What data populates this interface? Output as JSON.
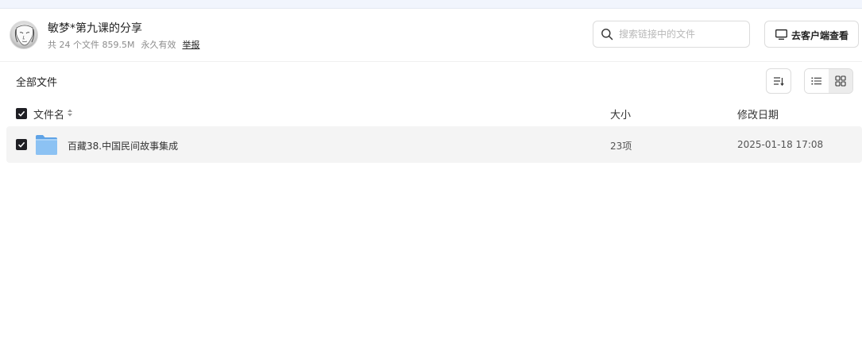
{
  "share": {
    "title": "敏梦*第九课的分享",
    "file_summary": "共 24 个文件 859.5M",
    "validity": "永久有效",
    "report_label": "举报"
  },
  "search": {
    "placeholder": "搜索链接中的文件",
    "value": ""
  },
  "client_button": {
    "label": "去客户端查看",
    "icon": "monitor-icon"
  },
  "toolbar": {
    "section_title": "全部文件",
    "sort_icon": "sort-list-icon",
    "view_options": [
      "list-view-icon",
      "grid-view-icon"
    ],
    "active_view": "grid"
  },
  "table": {
    "columns": {
      "name": "文件名",
      "size": "大小",
      "modified": "修改日期"
    },
    "select_all_checked": true,
    "rows": [
      {
        "checked": true,
        "type": "folder",
        "name": "百藏38.中国民间故事集成",
        "size": "23项",
        "modified": "2025-01-18 17:08"
      }
    ]
  },
  "colors": {
    "accent_dark": "#1f1f24",
    "folder_blue": "#7cb7f0",
    "row_highlight": "#f4f4f4"
  }
}
